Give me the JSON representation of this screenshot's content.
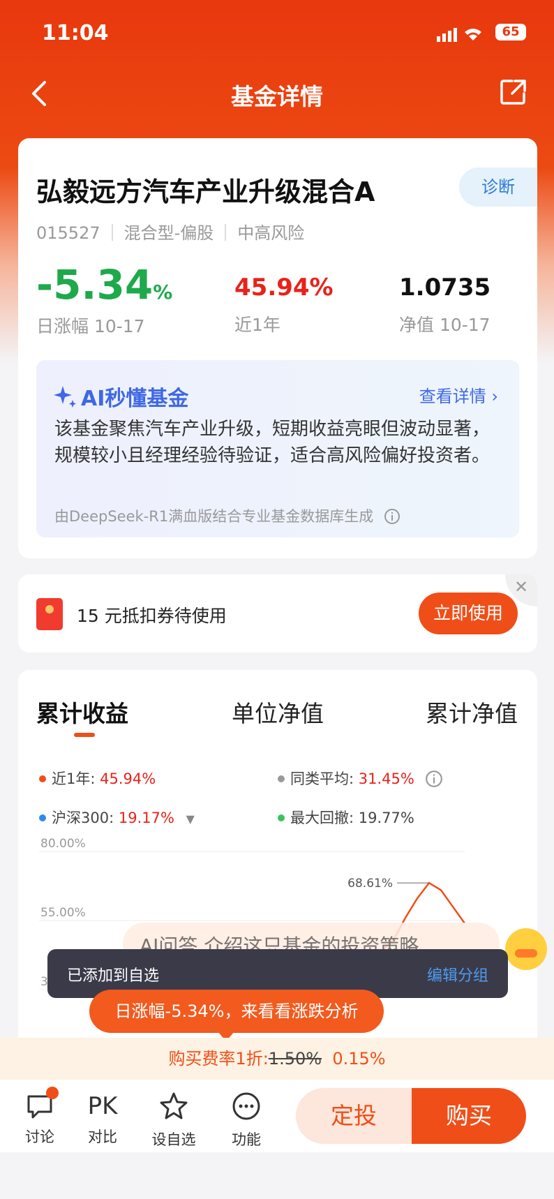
{
  "status": {
    "time": "11:04",
    "battery": "65"
  },
  "nav": {
    "title": "基金详情"
  },
  "fund": {
    "name": "弘毅远方汽车产业升级混合A",
    "diag_label": "诊断",
    "code": "015527",
    "type": "混合型-偏股",
    "risk": "中高风险",
    "daily_change": "-5.34",
    "daily_unit": "%",
    "daily_label": "日涨幅 10-17",
    "year_return": "45.94%",
    "year_label": "近1年",
    "nav_value": "1.0735",
    "nav_label": "净值 10-17"
  },
  "ai": {
    "title": "AI秒懂基金",
    "more": "查看详情",
    "text": "该基金聚焦汽车产业升级，短期收益亮眼但波动显著，规模较小且经理经验待验证，适合高风险偏好投资者。",
    "footer": "由DeepSeek-R1满血版结合专业基金数据库生成"
  },
  "coupon": {
    "text": "15 元抵扣券待使用",
    "button": "立即使用"
  },
  "tabs": [
    "累计收益",
    "单位净值",
    "累计净值"
  ],
  "legend": {
    "year": {
      "label": "近1年: ",
      "value": "45.94%"
    },
    "peer": {
      "label": "同类平均: ",
      "value": "31.45%"
    },
    "hs300": {
      "label": "沪深300: ",
      "value": "19.17%"
    },
    "drawdown": {
      "label": "最大回撤: ",
      "value": "19.77%"
    }
  },
  "colors": {
    "fund": "#f04e18",
    "peer": "#9a9a9a",
    "hs300": "#2a8cf0",
    "drawdown": "#3cc25b"
  },
  "chart_data": {
    "type": "line",
    "y_ticks": [
      "80.00%",
      "55.00%",
      "30.00%"
    ],
    "ylim": [
      30,
      80
    ],
    "annotation": "68.61%",
    "series": [
      {
        "values": [
          36,
          38,
          41,
          44,
          48,
          56,
          63,
          68.61,
          66,
          60,
          54
        ]
      }
    ]
  },
  "overlay": {
    "toast_text": "已添加到自选",
    "toast_action": "编辑分组",
    "ghost_text": "AI问答 介绍这只基金的投资策略",
    "bubble": "日涨幅-5.34%，来看看涨跌分析"
  },
  "fee": {
    "prefix": "购买费率1折:",
    "old": "1.50%",
    "new": "0.15%"
  },
  "bottom": {
    "discuss": "讨论",
    "pk_icon": "PK",
    "pk": "对比",
    "fav": "设自选",
    "func": "功能",
    "dingtou": "定投",
    "buy": "购买"
  }
}
